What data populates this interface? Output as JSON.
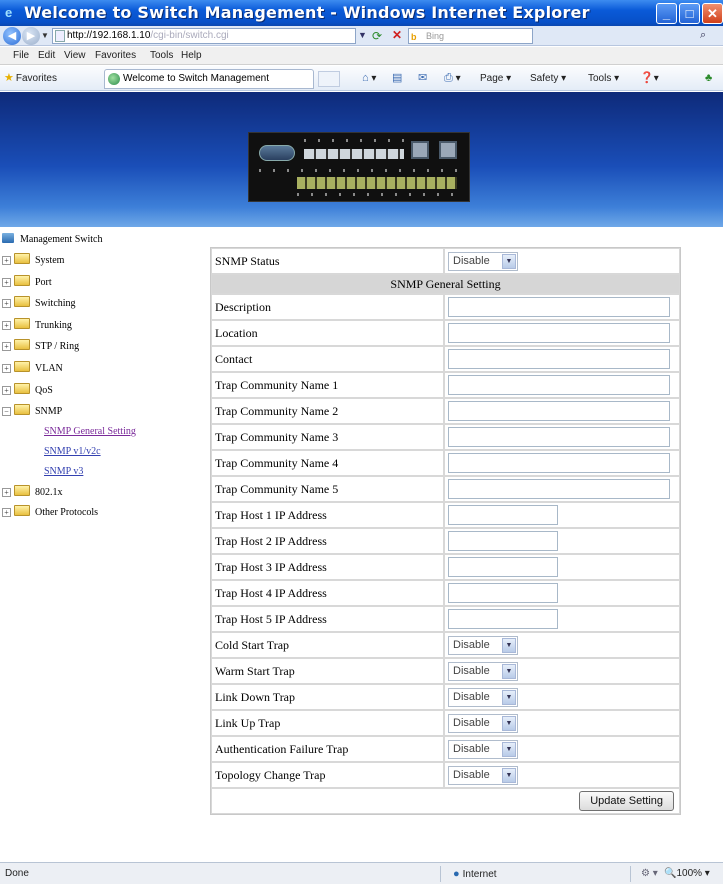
{
  "window": {
    "title": "Welcome to Switch Management - Windows Internet Explorer",
    "min_glyph": "_",
    "max_glyph": "□",
    "close_glyph": "✕"
  },
  "address": {
    "url_host": "http://192.168.1.10",
    "url_path": "/cgi-bin/switch.cgi",
    "search_placeholder": "Bing",
    "search_logo": "b"
  },
  "menu": [
    "File",
    "Edit",
    "View",
    "Favorites",
    "Tools",
    "Help"
  ],
  "favorites": {
    "label": "Favorites",
    "tab_title": "Welcome to Switch Management",
    "commands": [
      "Page ▾",
      "Safety ▾",
      "Tools ▾"
    ]
  },
  "sidebar": {
    "root": "Management Switch",
    "nodes": [
      "System",
      "Port",
      "Switching",
      "Trunking",
      "STP / Ring",
      "VLAN",
      "QoS",
      "SNMP",
      "802.1x",
      "Other Protocols"
    ],
    "snmp_links": [
      "SNMP General Setting",
      "SNMP v1/v2c",
      "SNMP v3"
    ],
    "expander_plus": "+",
    "expander_minus": "−"
  },
  "form": {
    "status_label": "SNMP Status",
    "status_value": "Disable",
    "section_header": "SNMP General Setting",
    "text_fields": [
      "Description",
      "Location",
      "Contact",
      "Trap Community Name 1",
      "Trap Community Name 2",
      "Trap Community Name 3",
      "Trap Community Name 4",
      "Trap Community Name 5"
    ],
    "ip_fields": [
      "Trap Host 1 IP Address",
      "Trap Host 2 IP Address",
      "Trap Host 3 IP Address",
      "Trap Host 4 IP Address",
      "Trap Host 5 IP Address"
    ],
    "trap_selects": [
      {
        "label": "Cold Start Trap",
        "value": "Disable"
      },
      {
        "label": "Warm Start Trap",
        "value": "Disable"
      },
      {
        "label": "Link Down Trap",
        "value": "Disable"
      },
      {
        "label": "Link Up Trap",
        "value": "Disable"
      },
      {
        "label": "Authentication Failure Trap",
        "value": "Disable"
      },
      {
        "label": "Topology Change Trap",
        "value": "Disable"
      }
    ],
    "update_button": "Update Setting"
  },
  "status": {
    "text": "Done",
    "zone": "Internet",
    "zoom": "100%"
  }
}
